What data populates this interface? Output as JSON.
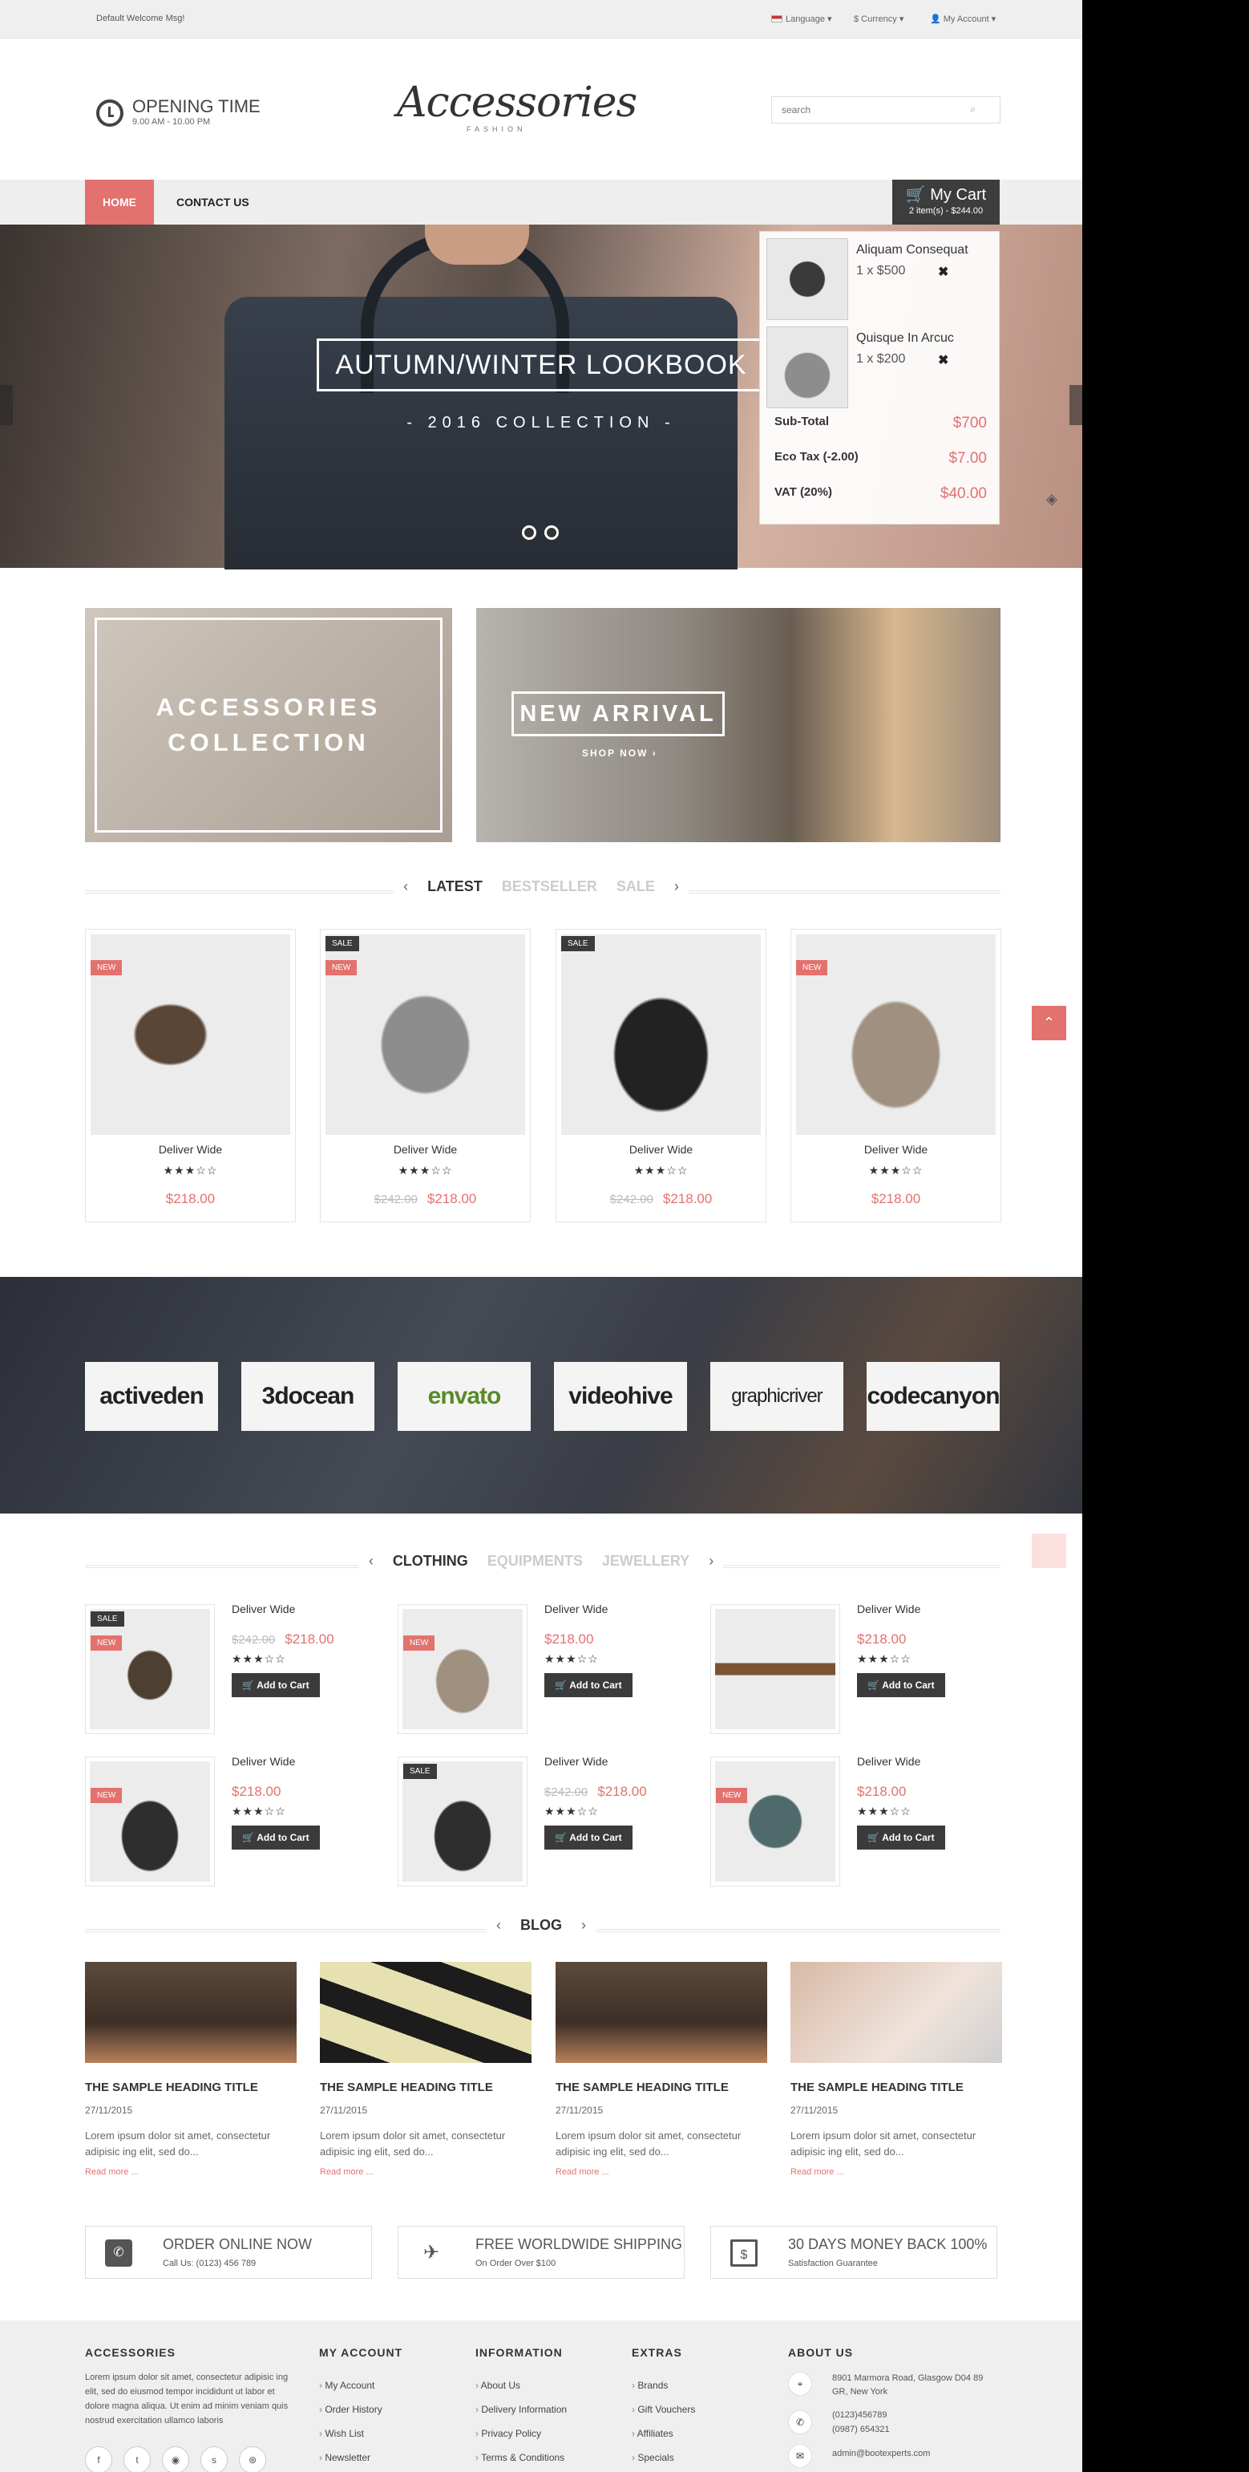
{
  "topbar": {
    "welcome": "Default Welcome Msg!",
    "language": "Language",
    "currency": "$ Currency",
    "account": "My Account"
  },
  "header": {
    "opening_title": "OPENING TIME",
    "opening_hours": "9.00 AM - 10.00 PM",
    "logo_title": "Accessories",
    "logo_sub": "FASHION",
    "search_placeholder": "search"
  },
  "nav": {
    "home": "HOME",
    "contact": "CONTACT US",
    "cart_label": "My Cart",
    "cart_summary": "2 item(s) - $244.00"
  },
  "slider": {
    "title": "AUTUMN/WINTER LOOKBOOK",
    "subtitle": "- 2016 COLLECTION -"
  },
  "cart_dropdown": {
    "items": [
      {
        "name": "Aliquam Consequat",
        "qty": "1 x $500"
      },
      {
        "name": "Quisque In Arcuc",
        "qty": "1 x $200"
      }
    ],
    "totals": [
      {
        "label": "Sub-Total",
        "value": "$700"
      },
      {
        "label": "Eco Tax (-2.00)",
        "value": "$7.00"
      },
      {
        "label": "VAT (20%)",
        "value": "$40.00"
      }
    ]
  },
  "banners": {
    "left_title": "ACCESSORIES COLLECTION",
    "right_title": "NEW ARRIVAL",
    "right_link": "SHOP NOW ›"
  },
  "product_tabs": [
    "LATEST",
    "BESTSELLER",
    "SALE"
  ],
  "products": [
    {
      "name": "Deliver Wide",
      "price": "$218.00",
      "old_price": "",
      "labels": [
        "NEW"
      ]
    },
    {
      "name": "Deliver Wide",
      "price": "$218.00",
      "old_price": "$242.00",
      "labels": [
        "SALE",
        "NEW"
      ]
    },
    {
      "name": "Deliver Wide",
      "price": "$218.00",
      "old_price": "$242.00",
      "labels": [
        "SALE"
      ]
    },
    {
      "name": "Deliver Wide",
      "price": "$218.00",
      "old_price": "",
      "labels": [
        "NEW"
      ]
    }
  ],
  "brands": [
    "activeden",
    "3docean",
    "envato",
    "videohive",
    "graphicriver",
    "codecanyon"
  ],
  "category_tabs": [
    "CLOTHING",
    "EQUIPMENTS",
    "JEWELLERY"
  ],
  "small_products": [
    {
      "name": "Deliver Wide",
      "price": "$218.00",
      "old_price": "$242.00",
      "labels": [
        "SALE",
        "NEW"
      ],
      "button": "Add to Cart"
    },
    {
      "name": "Deliver Wide",
      "price": "$218.00",
      "old_price": "",
      "labels": [
        "NEW"
      ],
      "button": "Add to Cart"
    },
    {
      "name": "Deliver Wide",
      "price": "$218.00",
      "old_price": "",
      "labels": [],
      "button": "Add to Cart"
    },
    {
      "name": "Deliver Wide",
      "price": "$218.00",
      "old_price": "",
      "labels": [
        "NEW"
      ],
      "button": "Add to Cart"
    },
    {
      "name": "Deliver Wide",
      "price": "$218.00",
      "old_price": "$242.00",
      "labels": [
        "SALE"
      ],
      "button": "Add to Cart"
    },
    {
      "name": "Deliver Wide",
      "price": "$218.00",
      "old_price": "",
      "labels": [
        "NEW"
      ],
      "button": "Add to Cart"
    }
  ],
  "blog": {
    "heading": "BLOG",
    "posts": [
      {
        "title": "THE SAMPLE HEADING TITLE",
        "date": "27/11/2015",
        "text": "Lorem ipsum dolor sit amet, consectetur adipisic ing elit, sed do...",
        "more": "Read more ..."
      },
      {
        "title": "THE SAMPLE HEADING TITLE",
        "date": "27/11/2015",
        "text": "Lorem ipsum dolor sit amet, consectetur adipisic ing elit, sed do...",
        "more": "Read more ..."
      },
      {
        "title": "THE SAMPLE HEADING TITLE",
        "date": "27/11/2015",
        "text": "Lorem ipsum dolor sit amet, consectetur adipisic ing elit, sed do...",
        "more": "Read more ..."
      },
      {
        "title": "THE SAMPLE HEADING TITLE",
        "date": "27/11/2015",
        "text": "Lorem ipsum dolor sit amet, consectetur adipisic ing elit, sed do...",
        "more": "Read more ..."
      }
    ]
  },
  "features": [
    {
      "title": "ORDER ONLINE NOW",
      "sub": "Call Us: (0123) 456 789"
    },
    {
      "title": "FREE WORLDWIDE SHIPPING",
      "sub": "On Order Over $100"
    },
    {
      "title": "30 DAYS MONEY BACK 100%",
      "sub": "Satisfaction Guarantee"
    }
  ],
  "footer": {
    "accessories_title": "ACCESSORIES",
    "accessories_text": "Lorem ipsum dolor sit amet, consectetur adipisic ing elit, sed do eiusmod tempor incididunt ut labor et dolore magna aliqua. Ut enim ad minim veniam quis nostrud exercitation ullamco laboris",
    "account_title": "MY ACCOUNT",
    "account_links": [
      "My Account",
      "Order History",
      "Wish List",
      "Newsletter"
    ],
    "info_title": "INFORMATION",
    "info_links": [
      "About Us",
      "Delivery Information",
      "Privacy Policy",
      "Terms & Conditions"
    ],
    "extras_title": "EXTRAS",
    "extras_links": [
      "Brands",
      "Gift Vouchers",
      "Affiliates",
      "Specials"
    ],
    "about_title": "ABOUT US",
    "address": "8901 Marmora Road, Glasgow D04 89 GR, New York",
    "phone1": "(0123)456789",
    "phone2": "(0987) 654321",
    "email": "admin@bootexperts.com"
  },
  "colors": {
    "accent": "#e3716e",
    "dark": "#3b3b3b"
  }
}
